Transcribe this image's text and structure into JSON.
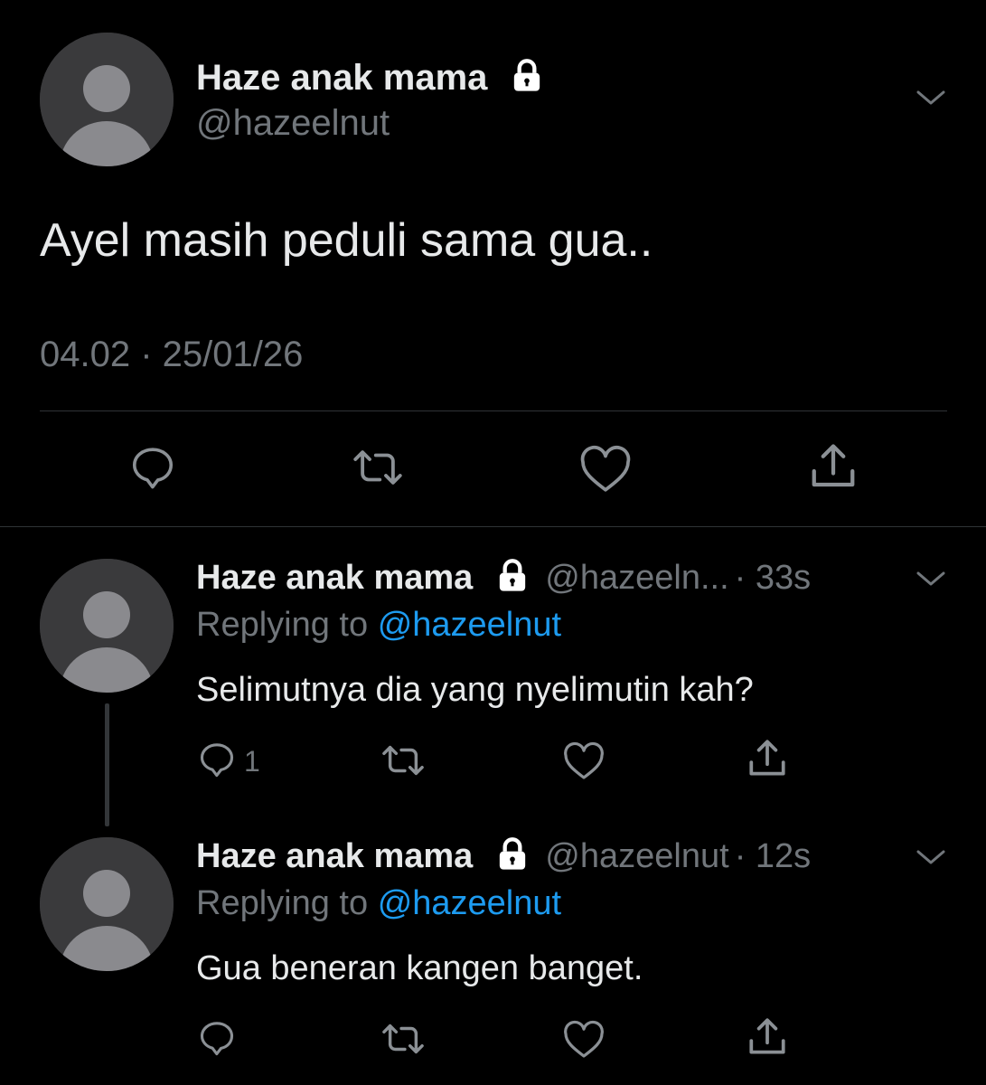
{
  "main_tweet": {
    "display_name": "Haze anak mama",
    "handle": "@hazeelnut",
    "text": "Ayel masih peduli sama gua..",
    "timestamp": "04.02 · 25/01/26"
  },
  "replies": [
    {
      "display_name": "Haze anak mama",
      "handle": "@hazeeln...",
      "time": "· 33s",
      "replying_label": "Replying to",
      "replying_handle": "@hazeelnut",
      "text": "Selimutnya dia yang nyelimutin kah?",
      "reply_count": "1"
    },
    {
      "display_name": "Haze anak mama",
      "handle": "@hazeelnut",
      "time": "· 12s",
      "replying_label": "Replying to",
      "replying_handle": "@hazeelnut",
      "text": "Gua beneran kangen banget.",
      "reply_count": ""
    }
  ],
  "icons": {
    "lock": "lock-icon",
    "chevron": "chevron-down-icon",
    "reply": "reply-icon",
    "retweet": "retweet-icon",
    "like": "heart-icon",
    "share": "share-icon"
  },
  "colors": {
    "background": "#000000",
    "text": "#e7e9ea",
    "muted": "#71767b",
    "link": "#1d9bf0",
    "avatar": "#3a3a3c"
  }
}
